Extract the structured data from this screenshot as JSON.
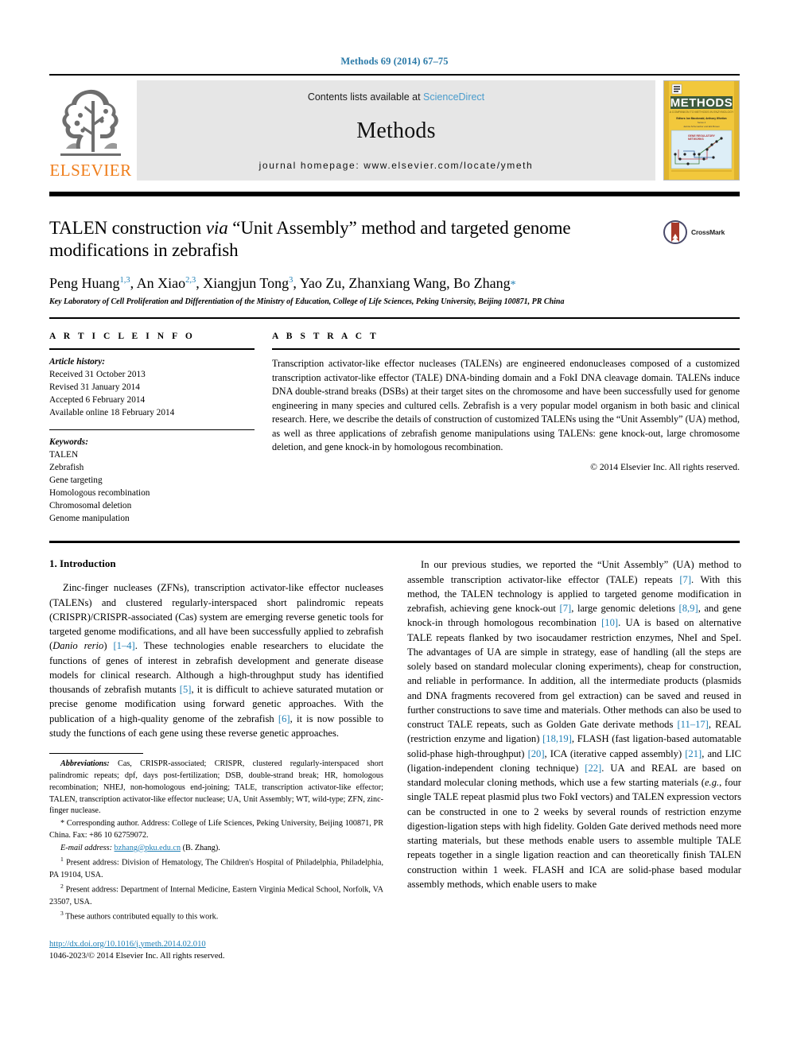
{
  "running_head": "Methods 69 (2014) 67–75",
  "masthead": {
    "publisher_name": "ELSEVIER",
    "contents_prefix": "Contents lists available at ",
    "sciencedirect": "ScienceDirect",
    "journal_name": "Methods",
    "homepage": "journal homepage: www.elsevier.com/locate/ymeth",
    "cover_title": "METHODS",
    "cover_subtitle": "A COMPANION TO METHODS IN ENZYMOLOGY",
    "cover_editor_line": "Editors: Ian Macdonald, Anthony Whetton",
    "cover_series_line": "Series 4",
    "cover_series_line2": "Jacinta Schumacher and Erik Bowen",
    "cover_inset_label": "GENE REGULATORY NETWORKS"
  },
  "article": {
    "title_part1": "TALEN construction ",
    "title_via": "via",
    "title_part2": " “Unit Assembly” method and targeted genome modifications in zebrafish",
    "crossmark_label": "CrossMark",
    "authors_html": "Peng Huang, An Xiao, Xiangjun Tong, Yao Zu, Zhanxiang Wang, Bo Zhang",
    "authors": [
      {
        "name": "Peng Huang",
        "sup": "1,3"
      },
      {
        "name": "An Xiao",
        "sup": "2,3"
      },
      {
        "name": "Xiangjun Tong",
        "sup": "3"
      },
      {
        "name": "Yao Zu",
        "sup": ""
      },
      {
        "name": "Zhanxiang Wang",
        "sup": ""
      },
      {
        "name": "Bo Zhang",
        "sup": "*"
      }
    ],
    "affiliation": "Key Laboratory of Cell Proliferation and Differentiation of the Ministry of Education, College of Life Sciences, Peking University, Beijing 100871, PR China"
  },
  "article_info": {
    "heading": "A R T I C L E   I N F O",
    "history_label": "Article history:",
    "history": [
      "Received 31 October 2013",
      "Revised 31 January 2014",
      "Accepted 6 February 2014",
      "Available online 18 February 2014"
    ],
    "keywords_label": "Keywords:",
    "keywords": [
      "TALEN",
      "Zebrafish",
      "Gene targeting",
      "Homologous recombination",
      "Chromosomal deletion",
      "Genome manipulation"
    ]
  },
  "abstract": {
    "heading": "A B S T R A C T",
    "text": "Transcription activator-like effector nucleases (TALENs) are engineered endonucleases composed of a customized transcription activator-like effector (TALE) DNA-binding domain and a FokI DNA cleavage domain. TALENs induce DNA double-strand breaks (DSBs) at their target sites on the chromosome and have been successfully used for genome engineering in many species and cultured cells. Zebrafish is a very popular model organism in both basic and clinical research. Here, we describe the details of construction of customized TALENs using the “Unit Assembly” (UA) method, as well as three applications of zebrafish genome manipulations using TALENs: gene knock-out, large chromosome deletion, and gene knock-in by homologous recombination.",
    "copyright": "© 2014 Elsevier Inc. All rights reserved."
  },
  "body": {
    "section_title": "1. Introduction",
    "left_paragraph_segments": [
      {
        "t": "Zinc-finger nucleases (ZFNs), transcription activator-like effector nucleases (TALENs) and clustered regularly-interspaced short palindromic repeats (CRISPR)/CRISPR-associated (Cas) system are emerging reverse genetic tools for targeted genome modifications, and all have been successfully applied to zebrafish ("
      },
      {
        "t": "Danio rerio",
        "style": "italic"
      },
      {
        "t": ") "
      },
      {
        "t": "[1–4]",
        "style": "ref"
      },
      {
        "t": ". These technologies enable researchers to elucidate the functions of genes of interest in zebrafish development and generate disease models for clinical research. Although a high-throughput study has identified thousands of zebrafish mutants "
      },
      {
        "t": "[5]",
        "style": "ref"
      },
      {
        "t": ", it is difficult to achieve saturated mutation or precise genome modification using forward genetic approaches. With the publication of a high-quality genome of the zebrafish "
      },
      {
        "t": "[6]",
        "style": "ref"
      },
      {
        "t": ", it is now possible to study the functions of each gene using these reverse genetic approaches."
      }
    ],
    "right_paragraph_segments": [
      {
        "t": "In our previous studies, we reported the “Unit Assembly” (UA) method to assemble transcription activator-like effector (TALE) repeats "
      },
      {
        "t": "[7]",
        "style": "ref"
      },
      {
        "t": ". With this method, the TALEN technology is applied to targeted genome modification in zebrafish, achieving gene knock-out "
      },
      {
        "t": "[7]",
        "style": "ref"
      },
      {
        "t": ", large genomic deletions "
      },
      {
        "t": "[8,9]",
        "style": "ref"
      },
      {
        "t": ", and gene knock-in through homologous recombination "
      },
      {
        "t": "[10]",
        "style": "ref"
      },
      {
        "t": ". UA is based on alternative TALE repeats flanked by two isocaudamer restriction enzymes, NheI and SpeI. The advantages of UA are simple in strategy, ease of handling (all the steps are solely based on standard molecular cloning experiments), cheap for construction, and reliable in performance. In addition, all the intermediate products (plasmids and DNA fragments recovered from gel extraction) can be saved and reused in further constructions to save time and materials. Other methods can also be used to construct TALE repeats, such as Golden Gate derivate methods "
      },
      {
        "t": "[11–17]",
        "style": "ref"
      },
      {
        "t": ", REAL (restriction enzyme and ligation) "
      },
      {
        "t": "[18,19]",
        "style": "ref"
      },
      {
        "t": ", FLASH (fast ligation-based automatable solid-phase high-throughput) "
      },
      {
        "t": "[20]",
        "style": "ref"
      },
      {
        "t": ", ICA (iterative capped assembly) "
      },
      {
        "t": "[21]",
        "style": "ref"
      },
      {
        "t": ", and LIC (ligation-independent cloning technique) "
      },
      {
        "t": "[22]",
        "style": "ref"
      },
      {
        "t": ". UA and REAL are based on standard molecular cloning methods, which use a few starting materials ("
      },
      {
        "t": "e.g.",
        "style": "italic"
      },
      {
        "t": ", four single TALE repeat plasmid plus two FokI vectors) and TALEN expression vectors can be constructed in one to 2 weeks by several rounds of restriction enzyme digestion-ligation steps with high fidelity. Golden Gate derived methods need more starting materials, but these methods enable users to assemble multiple TALE repeats together in a single ligation reaction and can theoretically finish TALEN construction within 1 week. FLASH and ICA are solid-phase based modular assembly methods, which enable users to make"
      }
    ]
  },
  "footnotes": {
    "abbreviations_label": "Abbreviations:",
    "abbreviations_text": " Cas, CRISPR-associated; CRISPR, clustered regularly-interspaced short palindromic repeats; dpf, days post-fertilization; DSB, double-strand break; HR, homologous recombination; NHEJ, non-homologous end-joining; TALE, transcription activator-like effector; TALEN, transcription activator-like effector nuclease; UA, Unit Assembly; WT, wild-type; ZFN, zinc-finger nuclease.",
    "corresponding_marker": "*",
    "corresponding_text": " Corresponding author. Address: College of Life Sciences, Peking University, Beijing 100871, PR China. Fax: +86 10 62759072.",
    "email_label": "E-mail address:",
    "email_value": "bzhang@pku.edu.cn",
    "email_suffix": " (B. Zhang).",
    "present_address_1_marker": "1",
    "present_address_1": " Present address: Division of Hematology, The Children's Hospital of Philadelphia, Philadelphia, PA 19104, USA.",
    "present_address_2_marker": "2",
    "present_address_2": " Present address: Department of Internal Medicine, Eastern Virginia Medical School, Norfolk, VA 23507, USA.",
    "equal_contrib_marker": "3",
    "equal_contrib": " These authors contributed equally to this work."
  },
  "doi": {
    "url": "http://dx.doi.org/10.1016/j.ymeth.2014.02.010",
    "issn_line": "1046-2023/© 2014 Elsevier Inc. All rights reserved."
  },
  "colors": {
    "link_blue": "#1f7fb5",
    "sciencedirect_blue": "#4a9ccc",
    "elsevier_orange": "#ef7d1a",
    "masthead_gray": "#e6e6e6",
    "cover_yellow": "#f2c83c",
    "crossmark_red": "#a8392b"
  }
}
